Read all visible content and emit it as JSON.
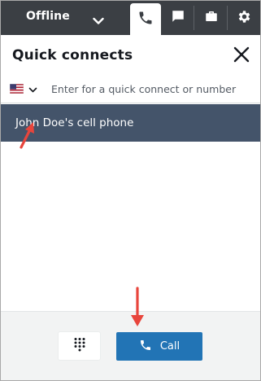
{
  "topbar": {
    "status_label": "Offline",
    "status_chevron_icon": "chevron-down-icon",
    "tabs": [
      {
        "icon": "phone-icon",
        "active": true
      },
      {
        "icon": "chat-icon",
        "active": false
      },
      {
        "icon": "briefcase-icon",
        "active": false
      },
      {
        "icon": "gear-icon",
        "active": false
      }
    ]
  },
  "panel": {
    "title": "Quick connects",
    "close_icon": "close-icon"
  },
  "search": {
    "country_flag_icon": "us-flag-icon",
    "placeholder": "Enter for a quick connect or number",
    "value": ""
  },
  "results": [
    {
      "label": "John Doe's cell phone"
    }
  ],
  "footer": {
    "keypad_icon": "dialpad-icon",
    "call_label": "Call",
    "call_icon": "phone-icon"
  },
  "annotations": {
    "arrow_color": "#e8453c"
  },
  "colors": {
    "topbar": "#3b3f44",
    "selected_row": "#44546a",
    "call_button": "#2274b5"
  }
}
